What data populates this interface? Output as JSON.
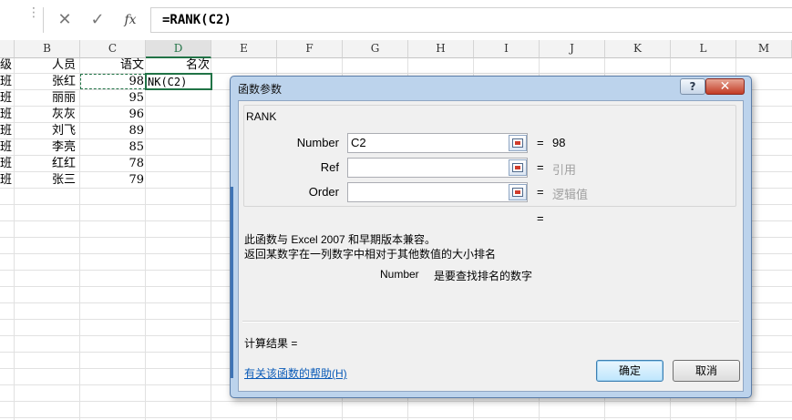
{
  "formula_bar": {
    "dots": "⋮",
    "cancel": "✕",
    "enter": "✓",
    "fx": "fx",
    "formula": "=RANK(C2)"
  },
  "columns": [
    "B",
    "C",
    "D",
    "E",
    "F",
    "G",
    "H",
    "I",
    "J",
    "K",
    "L",
    "M"
  ],
  "selected_column": "D",
  "sheet": {
    "header_row": {
      "a": "级",
      "b": "人员",
      "c": "语文",
      "d": "名次"
    },
    "rows": [
      {
        "a": "班",
        "b": "张红",
        "c": "98",
        "d": "NK(C2)"
      },
      {
        "a": "班",
        "b": "丽丽",
        "c": "95",
        "d": ""
      },
      {
        "a": "班",
        "b": "灰灰",
        "c": "96",
        "d": ""
      },
      {
        "a": "班",
        "b": "刘飞",
        "c": "89",
        "d": ""
      },
      {
        "a": "班",
        "b": "李亮",
        "c": "85",
        "d": ""
      },
      {
        "a": "班",
        "b": "红红",
        "c": "78",
        "d": ""
      },
      {
        "a": "班",
        "b": "张三",
        "c": "79",
        "d": ""
      }
    ]
  },
  "dialog": {
    "title": "函数参数",
    "help_button": "?",
    "close_button": "✕",
    "function_name": "RANK",
    "args": [
      {
        "label": "Number",
        "value": "C2",
        "eq": "=",
        "result": "98",
        "muted": false
      },
      {
        "label": "Ref",
        "value": "",
        "eq": "=",
        "result": "引用",
        "muted": true
      },
      {
        "label": "Order",
        "value": "",
        "eq": "=",
        "result": "逻辑值",
        "muted": true
      }
    ],
    "result_eq": "=",
    "desc1": "此函数与 Excel 2007 和早期版本兼容。",
    "desc2": "返回某数字在一列数字中相对于其他数值的大小排名",
    "arg_desc_name": "Number",
    "arg_desc_text": "是要查找排名的数字",
    "calc_result": "计算结果 =",
    "help_link": "有关该函数的帮助(H)",
    "ok": "确定",
    "cancel": "取消"
  }
}
